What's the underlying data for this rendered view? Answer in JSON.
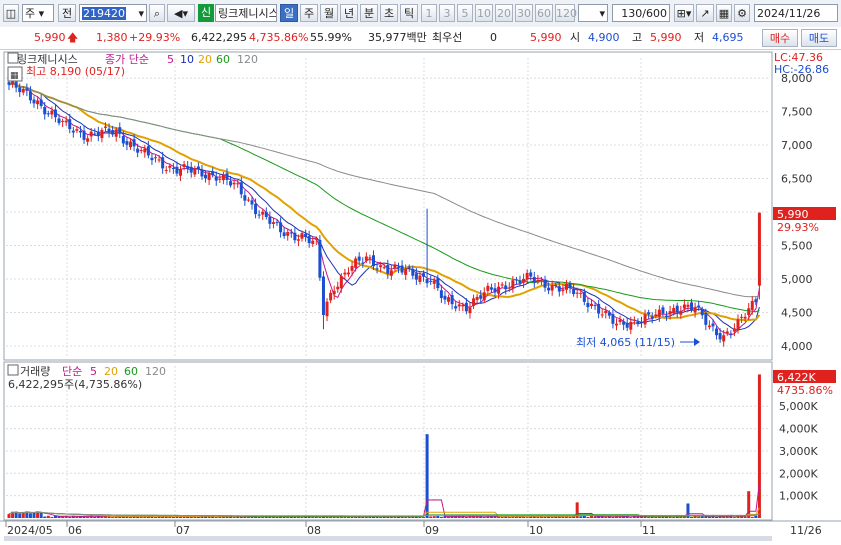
{
  "toolbar": {
    "market": "주",
    "prev_label": "전",
    "stock_code": "219420",
    "stock_name": "링크제니시스",
    "badge_sin": "신",
    "period_tabs": [
      "일",
      "주",
      "월",
      "년",
      "분",
      "초",
      "틱"
    ],
    "active_period": "일",
    "minute_options": [
      "1",
      "3",
      "5",
      "10",
      "20",
      "30",
      "60",
      "120"
    ],
    "count": "130/600",
    "date": "2024/11/26"
  },
  "quote": {
    "price": "5,990",
    "change": "1,380",
    "change_pct": "+29.93%",
    "volume": "6,422,295",
    "volume_pct": "4,735.86%",
    "turnover": "55.99%",
    "amount": "35,977백만",
    "priority_label": "최우선",
    "priority_value": "0",
    "bid_price": "5,990",
    "open_label": "시",
    "open": "4,900",
    "high_label": "고",
    "high": "5,990",
    "low_label": "저",
    "low": "4,695",
    "buy_label": "매수",
    "sell_label": "매도"
  },
  "price_panel": {
    "legend_name": "링크제니시스",
    "legend_close": "종가 단순",
    "ma_labels": [
      "5",
      "10",
      "20",
      "60",
      "120"
    ],
    "ma_colors": [
      "#c2188f",
      "#1a2fb0",
      "#e0a200",
      "#199a19",
      "#8a8a8a"
    ],
    "high_marker": "최고 8,190 (05/17)",
    "low_marker": "최저 4,065 (11/15)",
    "lc": "LC:47.36",
    "hc": "HC:-26.86",
    "last_price_tag": "5,990",
    "last_pct_tag": "29.93%",
    "y_ticks": [
      "8,000",
      "7,500",
      "7,000",
      "6,500",
      "6,000",
      "5,500",
      "5,000",
      "4,500",
      "4,000"
    ]
  },
  "volume_panel": {
    "legend_name": "거래량",
    "legend_simple": "단순",
    "ma_labels": [
      "5",
      "20",
      "60",
      "120"
    ],
    "ma_colors": [
      "#c2188f",
      "#e0a200",
      "#199a19",
      "#8a8a8a"
    ],
    "volume_text": "6,422,295주(4,735.86%)",
    "last_volume_tag": "6,422K",
    "last_pct_tag": "4735.86%",
    "y_ticks": [
      "5,000K",
      "4,000K",
      "3,000K",
      "2,000K",
      "1,000K"
    ]
  },
  "x_axis": {
    "labels": [
      "2024/05",
      "06",
      "07",
      "08",
      "09",
      "10",
      "11"
    ],
    "end_label": "11/26"
  },
  "colors": {
    "up": "#e0221f",
    "down": "#1b4fd1",
    "grid": "#d9d9d9",
    "price_tag_bg": "#e0221f"
  },
  "chart_data": {
    "type": "candlestick",
    "price_range": [
      4000,
      8190
    ],
    "volume_range": [
      0,
      6422295
    ],
    "last_candle": {
      "date": "11/26",
      "open": 4900,
      "high": 5990,
      "low": 4695,
      "close": 5990,
      "volume": 6422295
    },
    "period_high": {
      "value": 8190,
      "date": "05/17"
    },
    "period_low": {
      "value": 4065,
      "date": "11/15"
    },
    "series": [
      {
        "name": "5",
        "description_color": "#c2188f"
      },
      {
        "name": "10",
        "description_color": "#1a2fb0"
      },
      {
        "name": "20",
        "description_color": "#e0a200"
      },
      {
        "name": "60",
        "description_color": "#199a19"
      },
      {
        "name": "120",
        "description_color": "#8a8a8a"
      }
    ]
  }
}
